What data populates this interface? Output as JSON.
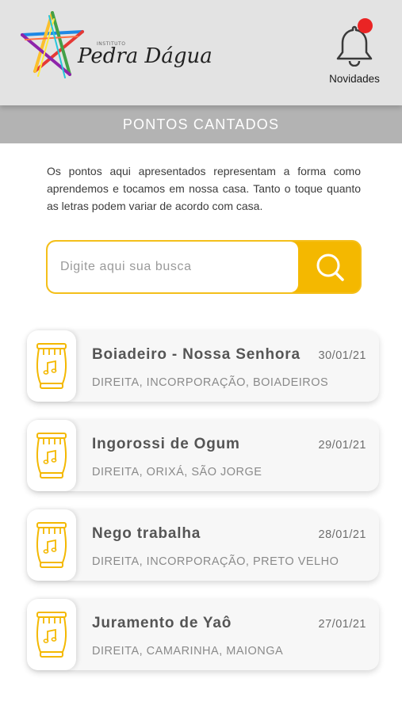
{
  "brand": {
    "institute_label": "INSTITUTO",
    "name": "Pedra Dágua"
  },
  "notifications": {
    "label": "Novidades",
    "icon": "bell-icon",
    "badge_color": "#ea2424"
  },
  "section": {
    "title": "PONTOS CANTADOS"
  },
  "intro_text": "Os pontos aqui apresentados representam a forma como aprendemos e tocamos em nossa casa. Tanto o toque quanto as letras podem variar de acordo com casa.",
  "search": {
    "placeholder": "Digite aqui sua busca",
    "value": "",
    "button_icon": "search-icon",
    "accent_color": "#f4b800"
  },
  "items": [
    {
      "title": "Boiadeiro - Nossa Senhora",
      "date": "30/01/21",
      "tags": "DIREITA, INCORPORAÇÃO, BOIADEIROS",
      "icon": "drum-icon"
    },
    {
      "title": "Ingorossi de Ogum",
      "date": "29/01/21",
      "tags": "DIREITA, ORIXÁ, SÃO JORGE",
      "icon": "drum-icon"
    },
    {
      "title": "Nego trabalha",
      "date": "28/01/21",
      "tags": "DIREITA, INCORPORAÇÃO, PRETO VELHO",
      "icon": "drum-icon"
    },
    {
      "title": "Juramento de Yaô",
      "date": "27/01/21",
      "tags": "DIREITA, CAMARINHA, MAIONGA",
      "icon": "drum-icon"
    }
  ]
}
